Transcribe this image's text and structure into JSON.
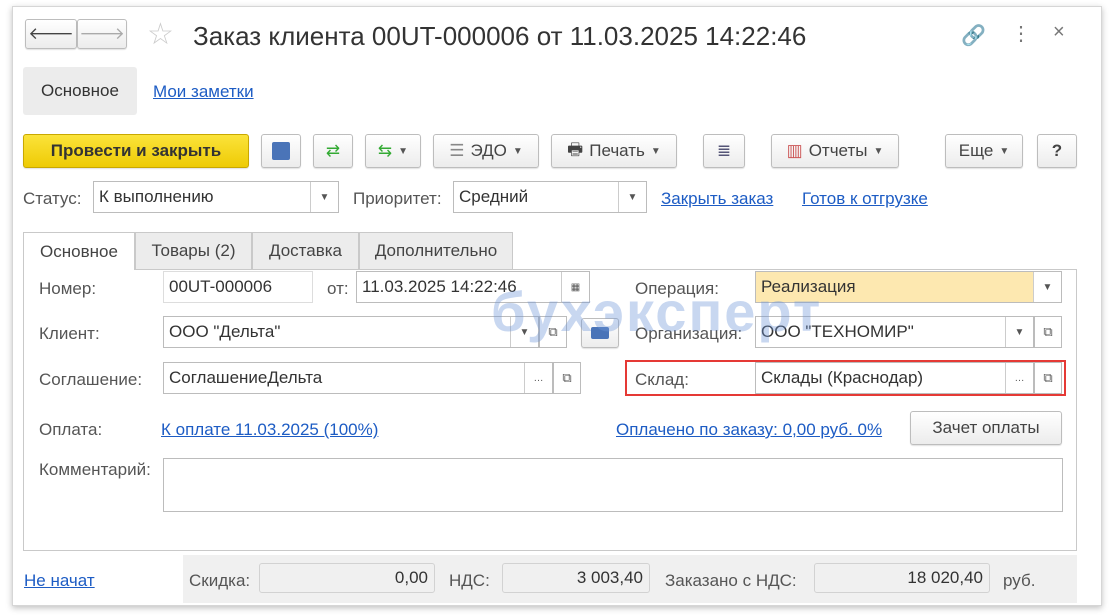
{
  "window": {
    "title": "Заказ клиента 00UT-000006 от 11.03.2025 14:22:46"
  },
  "nav": {
    "section_main": "Основное",
    "section_notes": "Мои заметки"
  },
  "toolbar": {
    "post_close": "Провести и закрыть",
    "edo": "ЭДО",
    "print": "Печать",
    "reports": "Отчеты",
    "more": "Еще",
    "help": "?"
  },
  "status": {
    "label": "Статус:",
    "value": "К выполнению",
    "priority_label": "Приоритет:",
    "priority_value": "Средний",
    "close_order": "Закрыть заказ",
    "ready_ship": "Готов к отгрузке"
  },
  "tabs": [
    "Основное",
    "Товары (2)",
    "Доставка",
    "Дополнительно"
  ],
  "form": {
    "number_label": "Номер:",
    "number": "00UT-000006",
    "date_label": "от:",
    "date": "11.03.2025 14:22:46",
    "operation_label": "Операция:",
    "operation": "Реализация",
    "client_label": "Клиент:",
    "client": "ООО \"Дельта\"",
    "org_label": "Организация:",
    "org": "ООО \"ТЕХНОМИР\"",
    "agreement_label": "Соглашение:",
    "agreement": "СоглашениеДельта",
    "warehouse_label": "Склад:",
    "warehouse": "Склады (Краснодар)",
    "payment_label": "Оплата:",
    "payment_link": "К оплате 11.03.2025 (100%)",
    "paid_link": "Оплачено по заказу: 0,00 руб. 0%",
    "offset_button": "Зачет оплаты",
    "comment_label": "Комментарий:",
    "comment": ""
  },
  "footer": {
    "state": "Не начат",
    "discount_label": "Скидка:",
    "discount": "0,00",
    "vat_label": "НДС:",
    "vat": "3 003,40",
    "total_label": "Заказано с НДС:",
    "total": "18 020,40",
    "currency": "руб."
  },
  "watermark": "бухэксперт",
  "colors": {
    "primary_button": "#f5d417",
    "highlight_field": "#fde8b0",
    "alert_border": "#e53935",
    "link": "#1d5cc4"
  }
}
